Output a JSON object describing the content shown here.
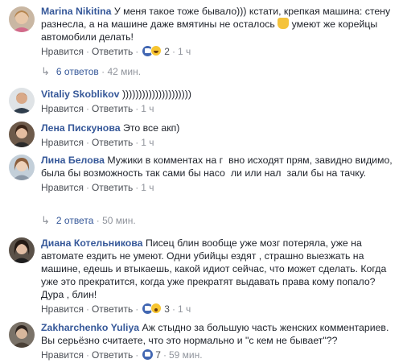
{
  "comments": [
    {
      "name": "Marina Nikitina",
      "text_1": "У меня такое тоже бывало))) кстати, крепкая машина: стену разнесла, а на машине даже вмятины не осталось",
      "text_2": " умеют же корейцы автомобили делать!",
      "like": "Нравится",
      "reply": "Ответить",
      "reactions": [
        "like-icon",
        "haha-icon"
      ],
      "reaction_count": "2",
      "time": "1 ч"
    },
    {
      "name": "Vitaliy Skoblikov",
      "text": ")))))))))))))))))))))",
      "like": "Нравится",
      "reply": "Ответить",
      "time": "1 ч"
    },
    {
      "name": "Лена Пискунова",
      "text": "Это все акп)",
      "like": "Нравится",
      "reply": "Ответить",
      "time": "1 ч"
    },
    {
      "name": "Лина Белова",
      "text_1": "Мужики в комментах на г",
      "text_2": "вно исходят прям, завидно видимо, была бы возможность так сами бы насо",
      "text_3": "ли или нал",
      "text_4": "зали бы на тачку.",
      "like": "Нравится",
      "reply": "Ответить",
      "time": "1 ч"
    },
    {
      "name": "Диана Котельникова",
      "text": "Писец блин вообще уже мозг потеряла, уже на автомате ездить не умеют. Одни убийцы ездят , страшно выезжать на машине, едешь и втыкаешь, какой идиот сейчас, что может сделать. Когда уже это прекратится, когда уже прекратят выдавать права кому попало? Дура , блин!",
      "like": "Нравится",
      "reply": "Ответить",
      "reactions": [
        "like-icon",
        "wow-icon"
      ],
      "reaction_count": "3",
      "time": "1 ч"
    },
    {
      "name": "Zakharchenko Yuliya",
      "text": "Аж стыдно за большую часть женских комментариев. Вы серьёзно считаете, что это нормально и \"с кем не бывает\"??",
      "like": "Нравится",
      "reply": "Ответить",
      "reactions": [
        "like-icon"
      ],
      "reaction_count": "7",
      "time": "59 мин."
    }
  ],
  "replies_1": {
    "label": "6 ответов",
    "time": "42 мин."
  },
  "replies_2": {
    "label": "2 ответа",
    "time": "50 мин."
  },
  "dot": "·"
}
